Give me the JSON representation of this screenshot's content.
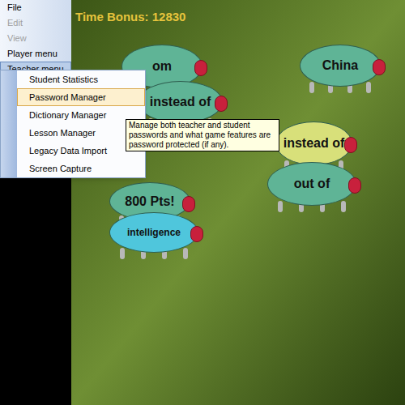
{
  "menu_bar": [
    {
      "label": "File",
      "disabled": false,
      "selected": false
    },
    {
      "label": "Edit",
      "disabled": true,
      "selected": false
    },
    {
      "label": "View",
      "disabled": true,
      "selected": false
    },
    {
      "label": "Player menu",
      "disabled": false,
      "selected": false
    },
    {
      "label": "Teacher menu",
      "disabled": false,
      "selected": true
    }
  ],
  "dropdown": {
    "items": [
      {
        "label": "Student Statistics",
        "selected": false
      },
      {
        "label": "Password Manager",
        "selected": true
      },
      {
        "label": "Dictionary Manager",
        "selected": false
      },
      {
        "label": "Lesson Manager",
        "selected": false
      },
      {
        "label": "Legacy Data Import",
        "selected": false
      },
      {
        "label": "Screen Capture",
        "selected": false
      }
    ]
  },
  "tooltip": {
    "text": "Manage both teacher and student passwords and what game features are password protected (if any)."
  },
  "game": {
    "time_bonus": "Time Bonus: 12830",
    "bugs": [
      {
        "label": "om",
        "color": "#5fb496"
      },
      {
        "label": "China",
        "color": "#5fb496"
      },
      {
        "label": "instead of",
        "color": "#5fb496"
      },
      {
        "label": "instead of",
        "color": "#d8e07a"
      },
      {
        "label": "out of",
        "color": "#5fb496"
      },
      {
        "label": "800 Pts!",
        "color": "#5fb496"
      },
      {
        "label": "intelligence",
        "color": "#4fc6dc"
      }
    ]
  }
}
